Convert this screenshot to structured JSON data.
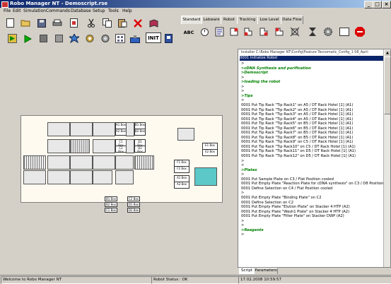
{
  "title": "Robo Manager NT - Demoscript.rse",
  "window_buttons": [
    "_",
    "□",
    "×"
  ],
  "menu": [
    "File",
    "Edit",
    "Simulation",
    "Commands",
    "Database",
    "Setup",
    "Tools",
    "Help"
  ],
  "command_tabs": [
    "Standard",
    "Labware",
    "Robot",
    "Tracking",
    "Low Level",
    "Data Flow"
  ],
  "toolbar": {
    "row1": [
      "new-doc",
      "open-folder",
      "save",
      "print",
      "print-preview",
      "run-doc",
      "cut",
      "copy",
      "paste",
      "delete",
      "help-book"
    ],
    "row2": [
      "run-abort",
      "play",
      "stop",
      "pause",
      "step",
      "config",
      "settings",
      "deck",
      "barcode",
      "init",
      "info"
    ],
    "init_label": "INIT",
    "cmd_abc": "ABC"
  },
  "deck": {
    "labels": [
      "A1 Box",
      "A2 Box",
      "B1 Box",
      "B2 Box",
      "C1 Box",
      "C2 Box",
      "D1 Box",
      "D2 Box",
      "E1 Box",
      "E2 Box",
      "F1 Box",
      "F2 Box"
    ]
  },
  "script": {
    "header": "Installer C:\\Robo Manager NT\\Config\\Feature Tecnomatic_Config_1 08_April",
    "selected": "0001  Initialize Robot",
    "lines": [
      {
        "t": ">",
        "g": false
      },
      {
        "t": ">cDNA Synthesis and purification",
        "g": true
      },
      {
        "t": ">Demoscript",
        "g": true
      },
      {
        "t": ">",
        "g": false
      },
      {
        "t": ">loading the robot",
        "g": true
      },
      {
        "t": ">",
        "g": false
      },
      {
        "t": ">",
        "g": false
      },
      {
        "t": ">Tips",
        "g": true
      },
      {
        "t": ">",
        "g": false
      },
      {
        "t": "0001  Put Tip Rack \"Tip Rack1\" on A5 / DT Rack Hotel [1] (A1)",
        "g": false
      },
      {
        "t": "0001  Put Tip Rack \"Tip Rack2\" on A5 / DT Rack Hotel [1] (A1)",
        "g": false
      },
      {
        "t": "0001  Put Tip Rack \"Tip Rack3\" on A5 / DT Rack Hotel [1] (A1)",
        "g": false
      },
      {
        "t": "0001  Put Tip Rack \"Tip Rack4\" on A5 / DT Rack Hotel [1] (A1)",
        "g": false
      },
      {
        "t": "0001  Put Tip Rack \"Tip Rack5\" on B5 / DT Rack Hotel [1] (A1)",
        "g": false
      },
      {
        "t": "0001  Put Tip Rack \"Tip Rack6\" on B5 / DT Rack Hotel [1] (A1)",
        "g": false
      },
      {
        "t": "0001  Put Tip Rack \"Tip Rack7\" on B5 / DT Rack Hotel [1] (A1)",
        "g": false
      },
      {
        "t": "0001  Put Tip Rack \"Tip Rack8\" on B5 / DT Rack Hotel [1] (A1)",
        "g": false
      },
      {
        "t": "0001  Put Tip Rack \"Tip Rack9\" on C5 / DT Rack Hotel [1] (A1)",
        "g": false
      },
      {
        "t": "0001  Put Tip Rack \"Tip Rack10\" on C5 / DT Rack Hotel [1] (A1)",
        "g": false
      },
      {
        "t": "0001  Put Tip Rack \"Tip Rack11\" on D5 / DT Rack Hotel [1] (A1)",
        "g": false
      },
      {
        "t": "0001  Put Tip Rack \"Tip Rack12\" on D5 / DT Rack Hotel [1] (A1)",
        "g": false
      },
      {
        "t": ">",
        "g": false
      },
      {
        "t": ">",
        "g": false
      },
      {
        "t": ">Plates",
        "g": true
      },
      {
        "t": ">",
        "g": false
      },
      {
        "t": "0001  Put Sample Plate on C3 / Flat Position cooled",
        "g": false
      },
      {
        "t": "0001  Put Empty Plate \"Reaction Plate for cDNA synthesis\" on C3 / D8 Position",
        "g": false
      },
      {
        "t": "0001  Define Selection on C4 / Flat Position cooled",
        "g": false
      },
      {
        "t": ">",
        "g": false
      },
      {
        "t": "0001  Put Empty Plate \"Binding Plate\" on C2",
        "g": false
      },
      {
        "t": "0001  Define Selection on C2",
        "g": false
      },
      {
        "t": "0001  Put Empty Plate \"Elution Plate\" on Stacker 4 HTP (A2)",
        "g": false
      },
      {
        "t": "0001  Put Empty Plate \"Wash1 Plate\" on Stacker 4 HTP (A2)",
        "g": false
      },
      {
        "t": "0001  Put Empty Plate \"Filter Plate\" on Stacker DWP (A2)",
        "g": false
      },
      {
        "t": ">",
        "g": false
      },
      {
        "t": ">",
        "g": false
      },
      {
        "t": ">Reagents",
        "g": true
      },
      {
        "t": ">",
        "g": false
      }
    ],
    "bottom_tabs": [
      "Script",
      "Parameters"
    ]
  },
  "status": {
    "welcome": "Welcome to Robo Manager NT",
    "robot_status": "Robot Status : OK",
    "datetime": "17.02.2008 10:59:57"
  },
  "colors": {
    "title_start": "#0a246a",
    "title_end": "#a6caf0",
    "deck_bg": "#fffaf0",
    "selected_line": "#0a246a",
    "comment_green": "#008000",
    "highlight_plate": "#5cc8c8"
  }
}
